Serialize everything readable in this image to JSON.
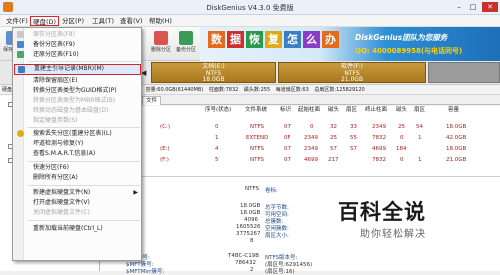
{
  "window": {
    "title": "DiskGenius V4.3.0 免费版",
    "minimize": "–",
    "maximize": "□",
    "close": "✕"
  },
  "menubar": [
    {
      "label": "文件(F)"
    },
    {
      "label": "硬盘(D)"
    },
    {
      "label": "分区(P)"
    },
    {
      "label": "工具(T)"
    },
    {
      "label": "查看(V)"
    },
    {
      "label": "帮助(H)"
    }
  ],
  "toolbar": {
    "save_label": "保存更改",
    "buttons": [
      {
        "label": "删除分区"
      },
      {
        "label": "备份分区"
      }
    ]
  },
  "banner": {
    "chars": [
      "数",
      "据",
      "恢",
      "复",
      "怎",
      "么",
      "办"
    ],
    "brand": "DiskGenius团队为您服务",
    "qq": "QQ: 4000089958(与电话同号)"
  },
  "diskmap": {
    "p1": {
      "name": "文档(E:)",
      "fs": "NTFS",
      "size": "18.0GB"
    },
    "p2": {
      "name": "软件(F:)",
      "fs": "NTFS",
      "size": "21.0GB"
    }
  },
  "diskinfo": {
    "label": "硬盘",
    "text": [
      "容量:60.0GB(61440MB)",
      "柱面数:7832",
      "磁头数:255",
      "每道扇区数:63",
      "总扇区数:125829120"
    ]
  },
  "tree": [
    "硬",
    "硬",
    "硬"
  ],
  "tabs": [
    "文件"
  ],
  "grid": {
    "headers": [
      "序号(状态)",
      "文件系统",
      "标识",
      "起始柱面",
      "磁头",
      "扇区",
      "终止柱面",
      "磁头",
      "扇区",
      "容量"
    ],
    "rows": [
      {
        "name": "(C:)",
        "idx": "0",
        "fs": "NTFS",
        "id": "07",
        "sc": "0",
        "sh": "32",
        "ss": "33",
        "ec": "2349",
        "eh": "25",
        "es": "54",
        "cap": "18.0GB"
      },
      {
        "name": "",
        "idx": "1",
        "fs": "EXTEND",
        "id": "0F",
        "sc": "2349",
        "sh": "25",
        "ss": "55",
        "ec": "7832",
        "eh": "0",
        "es": "1",
        "cap": "42.0GB"
      },
      {
        "name": "(E:)",
        "idx": "4",
        "fs": "NTFS",
        "id": "07",
        "sc": "2349",
        "sh": "57",
        "ss": "57",
        "ec": "4699",
        "eh": "184",
        "es": "",
        "cap": "18.0GB"
      },
      {
        "name": "(F:)",
        "idx": "5",
        "fs": "NTFS",
        "id": "07",
        "sc": "4699",
        "sh": "217",
        "ss": "",
        "ec": "7832",
        "eh": "0",
        "es": "1",
        "cap": "21.0GB"
      }
    ]
  },
  "details": {
    "left_values": [
      "NTFS",
      "18.0GB",
      "18.0GB",
      "4096",
      "1605526",
      "3775267",
      "8"
    ],
    "labels_right": [
      "卷标:",
      "总字节数:",
      "可用空间:",
      "总簇数:",
      "空闲簇数:",
      "扇区大小:"
    ],
    "bottom_labels": [
      "卷序列号:",
      "$MFT簇号:",
      "$MFTMirr簇号:"
    ],
    "bottom_values": [
      "T4BC-C19B",
      "786432",
      "2",
      "NTFS版本号:",
      "(扇区号:6291456)",
      "(扇区号:16)"
    ]
  },
  "dropdown": {
    "items": [
      {
        "label": "保存分区表(F8)",
        "disabled": true,
        "icon": "save-icon"
      },
      {
        "label": "备份分区表(F9)",
        "disabled": false,
        "icon": "backup-icon"
      },
      {
        "label": "还原分区表(F10)",
        "disabled": false,
        "icon": "restore-icon"
      },
      {
        "label": "重建主引导记录(MBR)(M)",
        "disabled": false,
        "icon": "mbr-icon",
        "highlight": true
      },
      {
        "label": "清除保留扇区(E)",
        "disabled": false
      },
      {
        "label": "转换分区表类型为GUID格式(P)",
        "disabled": false
      },
      {
        "label": "转换分区表类型为MBR格式(B)",
        "disabled": true
      },
      {
        "label": "转换动态磁盘为基本磁盘(D)",
        "disabled": true
      },
      {
        "label": "指定硬盘参数(S)",
        "disabled": true
      },
      {
        "label": "搜索丢失分区(重建分区表)(L)",
        "disabled": false,
        "icon": "search-icon"
      },
      {
        "label": "坏道检测与修复(Y)",
        "disabled": false
      },
      {
        "label": "查看S.M.A.R.T.信息(A)",
        "disabled": false
      },
      {
        "label": "快速分区(F6)",
        "disabled": false
      },
      {
        "label": "删除所有分区(A)",
        "disabled": false
      },
      {
        "label": "新建虚拟硬盘文件(N)",
        "disabled": false
      },
      {
        "label": "打开虚拟硬盘文件(V)",
        "disabled": false
      },
      {
        "label": "关闭虚拟硬盘文件(C)",
        "disabled": true
      },
      {
        "label": "重新加载当前硬盘(Ctrl_L)",
        "disabled": false
      }
    ]
  },
  "watermark": {
    "big": "百科全说",
    "small": "助你轻松解决"
  },
  "colors": {
    "accent_red": "#d8242a",
    "partition": "#b5852a",
    "value_red": "#b01f1f"
  }
}
